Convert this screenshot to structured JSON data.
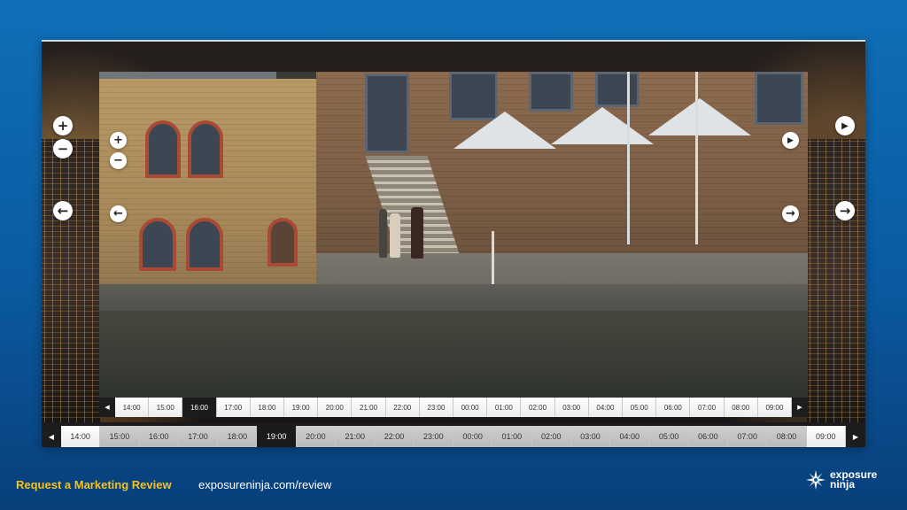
{
  "colors": {
    "background": "#0b5aa0",
    "cta": "#f4c21f",
    "timeline_active": "#1b1b1b"
  },
  "icons": {
    "zoom_in": "+",
    "zoom_out": "−",
    "prev": "←",
    "next": "→",
    "play": "▶",
    "scroll_left": "◀",
    "scroll_right": "▶"
  },
  "outer_viewer": {
    "timeline": [
      "14:00",
      "15:00",
      "16:00",
      "17:00",
      "18:00",
      "19:00",
      "20:00",
      "21:00",
      "22:00",
      "23:00",
      "00:00",
      "01:00",
      "02:00",
      "03:00",
      "04:00",
      "05:00",
      "06:00",
      "07:00",
      "08:00",
      "09:00"
    ],
    "active_time": "19:00"
  },
  "inner_viewer": {
    "timeline": [
      "14:00",
      "15:00",
      "16:00",
      "17:00",
      "18:00",
      "19:00",
      "20:00",
      "21:00",
      "22:00",
      "23:00",
      "00:00",
      "01:00",
      "02:00",
      "03:00",
      "04:00",
      "05:00",
      "06:00",
      "07:00",
      "08:00",
      "09:00"
    ],
    "active_time": "16:00"
  },
  "footer": {
    "cta": "Request a Marketing Review",
    "url": "exposureninja.com/review",
    "logo_line1": "exposure",
    "logo_line2": "ninja"
  }
}
